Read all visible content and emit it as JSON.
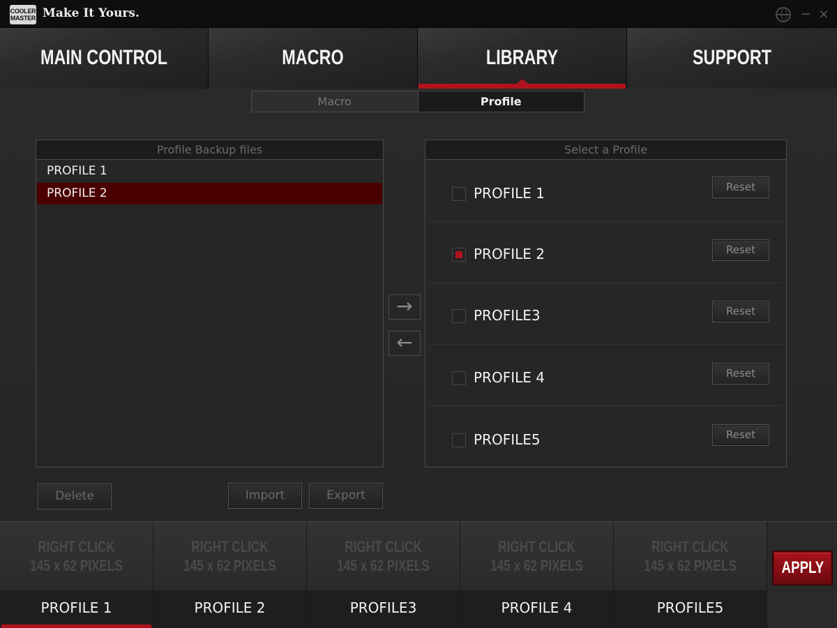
{
  "window": {
    "logo_text": "COOLER MASTER",
    "title": "Make It Yours.",
    "controls": {
      "language_icon": "globe-icon",
      "minimize": "−",
      "close": "×"
    }
  },
  "main_tabs": [
    {
      "label": "MAIN CONTROL",
      "active": false
    },
    {
      "label": "MACRO",
      "active": false
    },
    {
      "label": "LIBRARY",
      "active": true
    },
    {
      "label": "SUPPORT",
      "active": false
    }
  ],
  "sub_tabs": [
    {
      "label": "Macro",
      "active": false
    },
    {
      "label": "Profile",
      "active": true
    }
  ],
  "backup_panel": {
    "title": "Profile Backup files",
    "items": [
      {
        "label": "PROFILE 1",
        "selected": false
      },
      {
        "label": "PROFILE 2",
        "selected": true
      }
    ],
    "buttons": {
      "delete": "Delete",
      "import": "Import",
      "export": "Export"
    }
  },
  "transfer": {
    "right_arrow": "→",
    "left_arrow": "←"
  },
  "select_panel": {
    "title": "Select a Profile",
    "profiles": [
      {
        "label": "PROFILE 1",
        "checked": false,
        "reset": "Reset"
      },
      {
        "label": "PROFILE 2",
        "checked": true,
        "reset": "Reset"
      },
      {
        "label": "PROFILE3",
        "checked": false,
        "reset": "Reset"
      },
      {
        "label": "PROFILE 4",
        "checked": false,
        "reset": "Reset"
      },
      {
        "label": "PROFILE5",
        "checked": false,
        "reset": "Reset"
      }
    ]
  },
  "bottom_bar": {
    "slots": [
      {
        "placeholder_line1": "RIGHT CLICK",
        "placeholder_line2": "145 x 62 PIXELS",
        "name": "PROFILE 1",
        "active": true
      },
      {
        "placeholder_line1": "RIGHT CLICK",
        "placeholder_line2": "145 x 62 PIXELS",
        "name": "PROFILE 2",
        "active": false
      },
      {
        "placeholder_line1": "RIGHT CLICK",
        "placeholder_line2": "145 x 62 PIXELS",
        "name": "PROFILE3",
        "active": false
      },
      {
        "placeholder_line1": "RIGHT CLICK",
        "placeholder_line2": "145 x 62 PIXELS",
        "name": "PROFILE 4",
        "active": false
      },
      {
        "placeholder_line1": "RIGHT CLICK",
        "placeholder_line2": "145 x 62 PIXELS",
        "name": "PROFILE5",
        "active": false
      }
    ],
    "apply": "APPLY"
  },
  "colors": {
    "accent": "#b0131e",
    "selected_row": "#4a0000",
    "background": "#262626"
  }
}
